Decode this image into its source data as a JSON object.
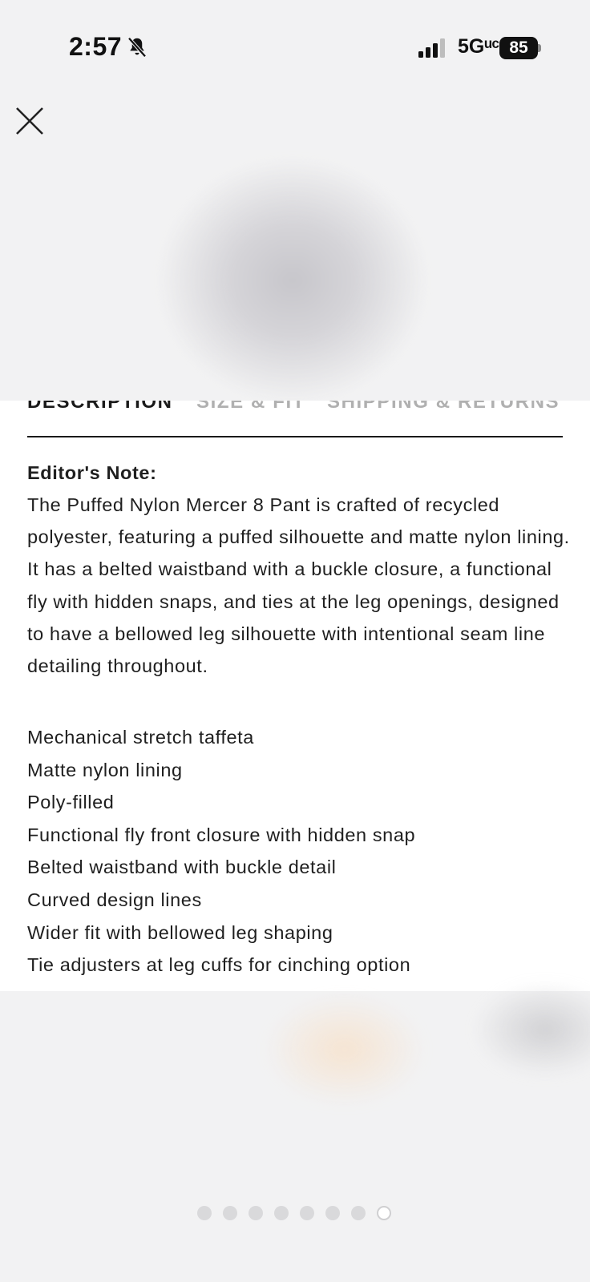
{
  "status_bar": {
    "time": "2:57",
    "network": "5Gᵘᶜ",
    "battery": "85"
  },
  "icons": {
    "close": "close-icon",
    "bell": "bell-muted-icon",
    "signal": "signal-icon"
  },
  "tabs": [
    {
      "label": "DESCRIPTION",
      "active": true
    },
    {
      "label": "SIZE & FIT",
      "active": false
    },
    {
      "label": "SHIPPING & RETURNS",
      "active": false
    }
  ],
  "description": {
    "heading": "Editor's Note:",
    "body": "The Puffed Nylon Mercer 8 Pant is crafted of recycled polyester, featuring a puffed silhouette and matte nylon lining. It has a belted waistband with a buckle closure, a functional fly with hidden snaps, and ties at the leg openings, designed to have a bellowed leg silhouette with intentional seam line detailing throughout.",
    "features": [
      "Mechanical stretch taffeta",
      "Matte nylon lining",
      "Poly-filled",
      "Functional fly front closure with hidden snap",
      "Belted waistband with buckle detail",
      "Curved design lines",
      "Wider fit with bellowed leg shaping",
      "Tie adjusters at leg cuffs for cinching option"
    ]
  },
  "carousel": {
    "total": 8,
    "active_index": 7
  }
}
